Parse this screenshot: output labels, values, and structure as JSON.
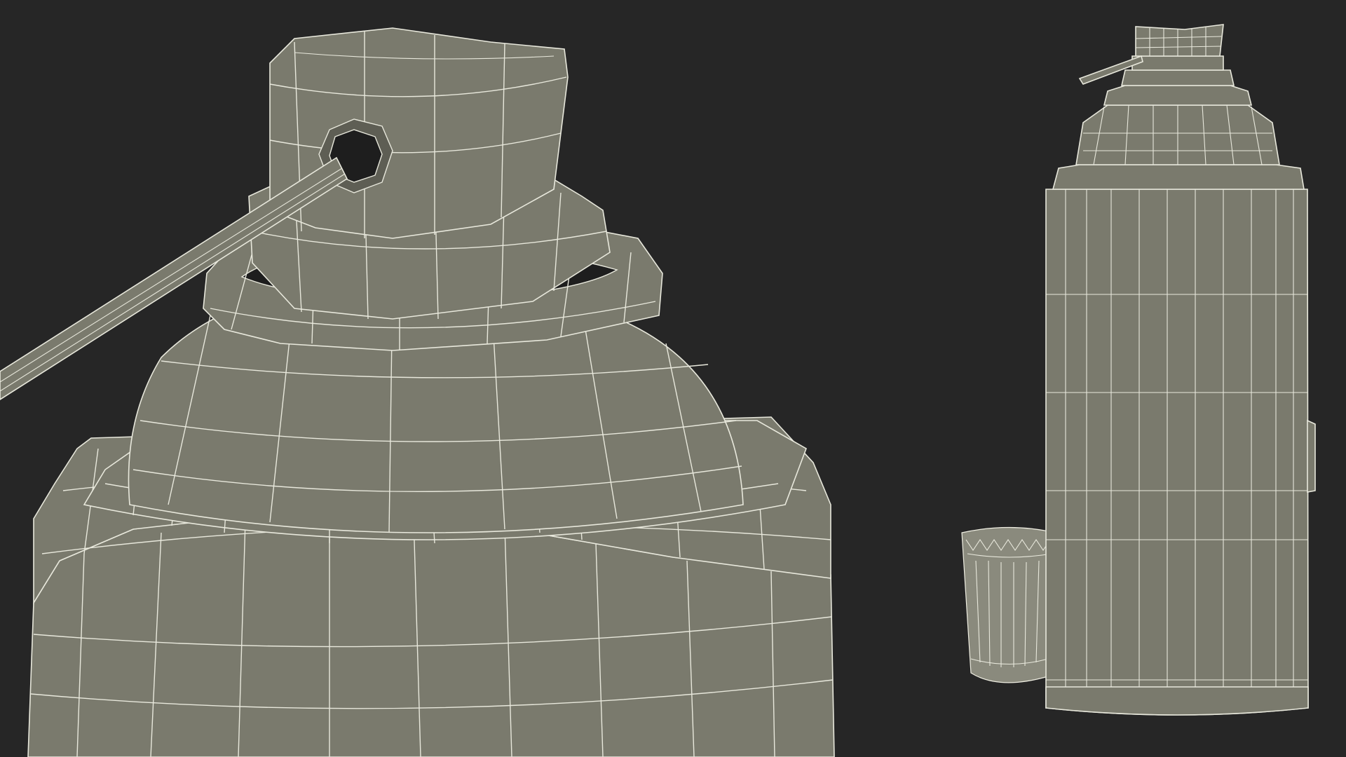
{
  "scene": {
    "background": "#262626",
    "mesh_fill": "#7a7a6d",
    "wire_color": "#e8e8dc",
    "views": [
      {
        "name": "closeup-view",
        "subject": "spray-can-top-wireframe"
      },
      {
        "name": "full-view",
        "subject": "spray-can-with-cap-wireframe"
      }
    ]
  }
}
